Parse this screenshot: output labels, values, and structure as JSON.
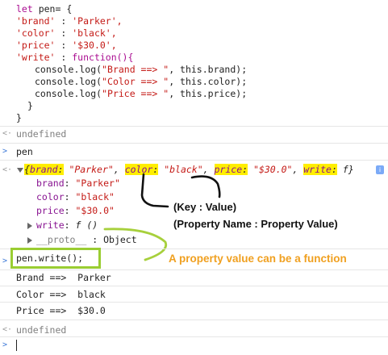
{
  "code": {
    "l1": "let pen= {",
    "l2_key": "'brand'",
    "l2_val": "'Parker',",
    "l3_key": "'color'",
    "l3_val": "'black',",
    "l4_key": "'price'",
    "l4_val": "'$30.0',",
    "l5_key": "'write'",
    "l5_fn": "function(){",
    "l6_a": "console.log(",
    "l6_s": "\"Brand ==> \"",
    "l6_b": ", this.brand);",
    "l7_a": "console.log(",
    "l7_s": "\"Color ==> \"",
    "l7_b": ", this.color);",
    "l8_a": "console.log(",
    "l8_s": "\"Price ==> \"",
    "l8_b": ", this.price);",
    "l9": "}",
    "l10": "}"
  },
  "outputs": {
    "undefined1": "undefined",
    "pen_cmd": "pen",
    "summary": {
      "brand_k": "brand",
      "brand_v": "\"Parker\"",
      "color_k": "color",
      "color_v": "\"black\"",
      "price_k": "price",
      "price_v": "\"$30.0\"",
      "write_k": "write",
      "write_v": "f}"
    },
    "props": [
      {
        "key": "brand",
        "val": "\"Parker\""
      },
      {
        "key": "color",
        "val": "\"black\""
      },
      {
        "key": "price",
        "val": "\"$30.0\""
      }
    ],
    "write_prop_key": "write",
    "write_prop_val": "f ()",
    "proto_key": "__proto__",
    "proto_val": "Object",
    "write_cmd": "pen.write();",
    "log_lines": [
      {
        "label": "Brand ==>",
        "value": "Parker"
      },
      {
        "label": "Color ==>",
        "value": "black"
      },
      {
        "label": "Price ==>",
        "value": "$30.0"
      }
    ],
    "undefined2": "undefined"
  },
  "annotations": {
    "key_value": "(Key : Value)",
    "prop_name_value": "(Property Name : Property Value)",
    "fn_note": "A property value can be a function"
  },
  "colors": {
    "highlight": "#ffee00",
    "green_box": "#9acd32",
    "orange_text": "#f0a020"
  }
}
